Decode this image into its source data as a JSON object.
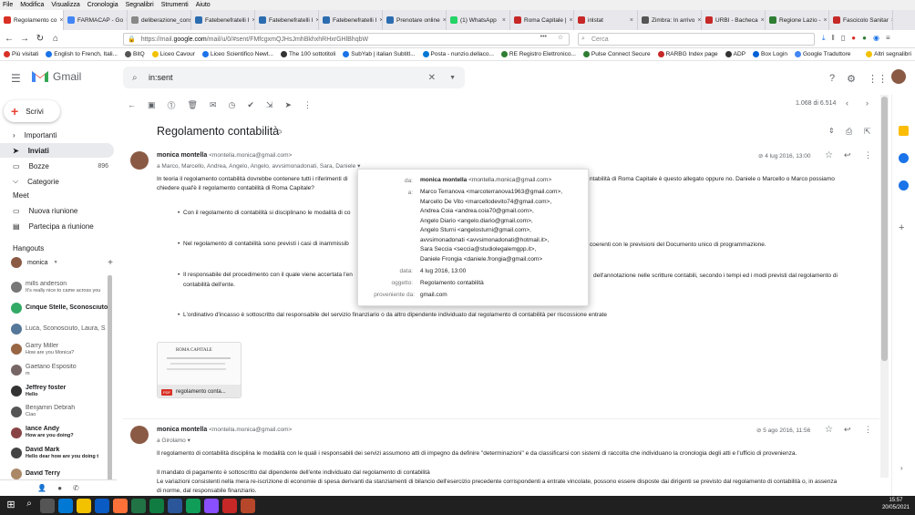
{
  "menubar": [
    "File",
    "Modifica",
    "Visualizza",
    "Cronologia",
    "Segnalibri",
    "Strumenti",
    "Aiuto"
  ],
  "tabs": [
    {
      "label": "Regolamento co",
      "color": "#d93025",
      "active": true
    },
    {
      "label": "FARMACAP - Go",
      "color": "#4285f4"
    },
    {
      "label": "deliberazione_consig",
      "color": "#888"
    },
    {
      "label": "Fatebenefratelli I",
      "color": "#2b6cb0"
    },
    {
      "label": "Fatebenefratelli I",
      "color": "#2b6cb0"
    },
    {
      "label": "Fatebenefratelli I",
      "color": "#2b6cb0"
    },
    {
      "label": "Prenotare online",
      "color": "#2b6cb0"
    },
    {
      "label": "(1) WhatsApp",
      "color": "#25d366"
    },
    {
      "label": "Roma Capitale |",
      "color": "#c62828"
    },
    {
      "label": "inlstat",
      "color": "#c62828"
    },
    {
      "label": "Zimbra: In arrivo",
      "color": "#555"
    },
    {
      "label": "URBI - Bacheca",
      "color": "#c62828"
    },
    {
      "label": "Regione Lazio -",
      "color": "#2e7d32"
    },
    {
      "label": "Fascicolo Sanitar",
      "color": "#c62828"
    }
  ],
  "url": {
    "prefix": "https://mail.",
    "domain": "google.com",
    "rest": "/mail/u/0/#sent/FMfcgxmQJHsJmhBkhxhRHxrGHlBhqbW"
  },
  "browser_search_placeholder": "Cerca",
  "bookmarks": [
    "Più visitati",
    "English to French, Itali...",
    "BitQ",
    "Liceo Cavour",
    "Liceo Scientifico Newt...",
    "The 100 sottotitoli",
    "SubYab | italian Subtitl...",
    "Posta - nunzio.dellaco...",
    "RE Registro Elettronico...",
    "Pulse Connect Secure",
    "RARBG Index page",
    "ADP",
    "Box Login",
    "Google Traduttore",
    "Altri segnalibri"
  ],
  "gmail": {
    "logo": "Gmail",
    "search_value": "in:sent",
    "compose": "Scrivi",
    "nav": [
      {
        "label": "Importanti"
      },
      {
        "label": "Inviati",
        "selected": true
      },
      {
        "label": "Bozze",
        "count": "896"
      },
      {
        "label": "Categorie"
      }
    ],
    "meet_title": "Meet",
    "meet": [
      "Nuova riunione",
      "Partecipa a riunione"
    ],
    "hangouts_title": "Hangouts",
    "hangouts_user": "monica",
    "contacts": [
      {
        "name": "mills anderson",
        "sub": "It's really nice to came across you",
        "color": "#777",
        "bold": false
      },
      {
        "name": "Cinque Stelle, Sconosciuto",
        "sub": "",
        "color": "#3a6",
        "bold": true
      },
      {
        "name": "Luca, Sconosciuto, Laura, S",
        "sub": "",
        "color": "#579",
        "bold": false
      },
      {
        "name": "Garry Miller",
        "sub": "How are you Monica?",
        "color": "#964",
        "bold": false
      },
      {
        "name": "Gaetano Esposito",
        "sub": "m",
        "color": "#766",
        "bold": false
      },
      {
        "name": "Jeffrey foster",
        "sub": "Hello",
        "color": "#333",
        "bold": true
      },
      {
        "name": "Benjamin Debrah",
        "sub": "Ciao",
        "color": "#555",
        "bold": false
      },
      {
        "name": "lance Andy",
        "sub": "How are you doing?",
        "color": "#844",
        "bold": true
      },
      {
        "name": "David Mark",
        "sub": "Hello dear how are you doing t",
        "color": "#444",
        "bold": true
      },
      {
        "name": "David Terry",
        "sub": "",
        "color": "#a86",
        "bold": true
      }
    ],
    "pagination": "1.068 di 6.514",
    "subject": "Regolamento contabilità",
    "msg1": {
      "sender": "monica montella",
      "email": "<montella.monica@gmail.com>",
      "to": "a Marco, Marcello, Andrea, Angelo, Angelo, avvsimonadonati, Sara, Daniele",
      "date": "4 lug 2016, 13:00",
      "line1": "In teoria il regolamento contabilità dovrebbe contenere tutti i riferimenti di",
      "line1b": "ntabilità di Roma Capitale è questo allegato oppure no. Daniele o Marcello o Marco possiamo",
      "line2": "chiedere qual'è il regolamento contabilità di Roma Capitale?",
      "b1": "Con il regolamento di contabilità si disciplinano le modalità di co",
      "b2": "Nel regolamento di contabilità sono previsti i casi di inammissib",
      "b2b": "coerenti con le previsioni del Documento unico di programmazione.",
      "b3": "Il responsabile del procedimento con il quale viene accertata l'en",
      "b3b": "dell'annotazione nelle scritture contabili, secondo i tempi ed i modi previsti dal regolamento di",
      "b3c": "contabilità dell'ente.",
      "b4": "L'ordinativo d'incasso è sottoscritto dal responsabile del servizio finanziario o da altro dipendente individuato dal regolamento di contabilità per riscossione entrate",
      "attachment": "regolamento conta...",
      "attach_header": "ROMA CAPITALE"
    },
    "popup": {
      "da_label": "da:",
      "da_name": "monica montella",
      "da_email": "<montella.monica@gmail.com>",
      "a_label": "a:",
      "recipients": [
        "Marco Terranova <marcoterranova1963@gmail.com>,",
        "Marcello De Vito <marcellodevito74@gmail.com>,",
        "Andrea Coia <andrea.coia70@gmail.com>,",
        "Angelo Diario <angelo.diario@gmail.com>,",
        "Angelo Sturni <angelosturni@gmail.com>,",
        "avvsimonadonati <avvsimonadonati@hotmail.it>,",
        "Sara Seccia <seccia@studiolegalemgpp.it>,",
        "Daniele Frongia <daniele.frongia@gmail.com>"
      ],
      "data_label": "data:",
      "data": "4 lug 2016, 13:00",
      "oggetto_label": "oggetto:",
      "oggetto": "Regolamento contabilità",
      "prov_label": "proveniente da:",
      "prov": "gmail.com"
    },
    "msg2": {
      "sender": "monica montella",
      "email": "<montella.monica@gmail.com>",
      "to": "a Girolamo",
      "date": "5 ago 2016, 11:56",
      "p1": "Il regolamento di contabilità disciplina le modalità con le quali i responsabili dei servizi assumono atti di impegno da definire \"determinazioni\" e da classificarsi con sistemi di raccolta che individuano la cronologia degli atti e l'ufficio di provenienza.",
      "p2": "Il mandato di pagamento è sottoscritto dal dipendente dell'ente individuato dal regolamento di contabilità",
      "p3": "Le variazioni consistenti nella mera re-iscrizione di economie di spesa derivanti da stanziamenti di bilancio dell'esercizio precedente corrispondenti a entrate vincolate, possono essere disposte dai dirigenti se previsto dal regolamento di contabilità o, in assenza",
      "p4": "di norme, dal responsabile finanziario."
    }
  },
  "taskbar": {
    "time": "15:57",
    "date": "20/05/2021"
  }
}
